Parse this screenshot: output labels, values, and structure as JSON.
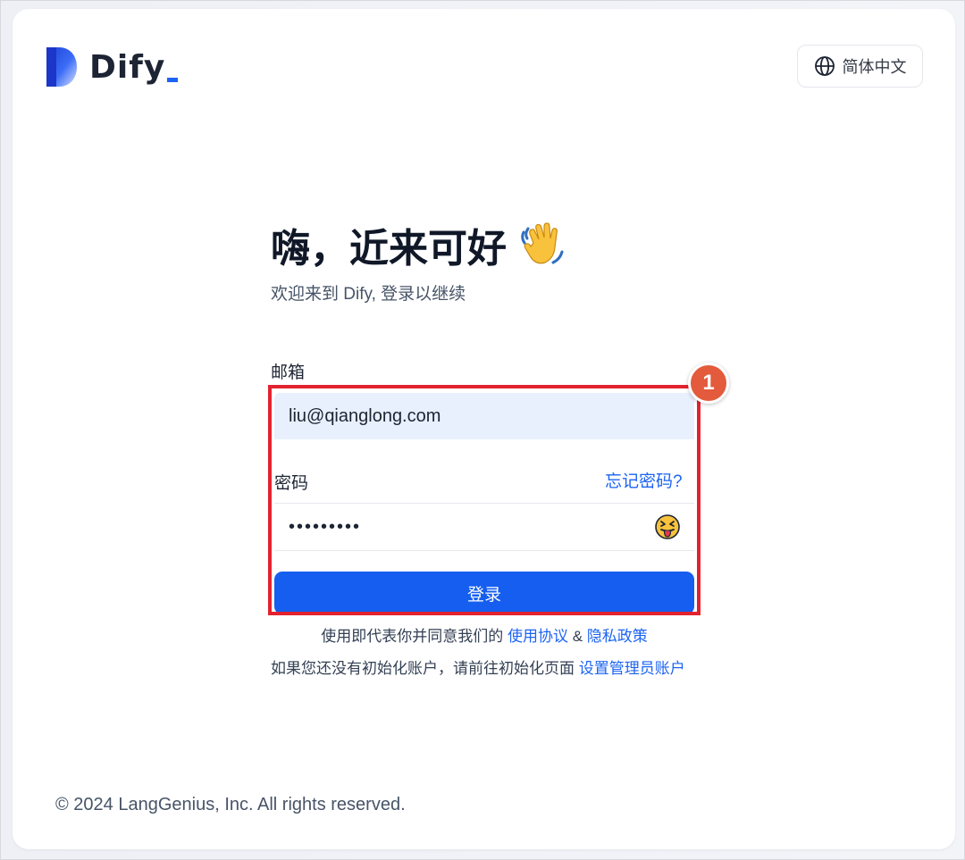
{
  "brand": {
    "name": "Dify"
  },
  "header": {
    "language_label": "简体中文"
  },
  "main": {
    "title": "嗨，近来可好",
    "subtitle": "欢迎来到 Dify, 登录以继续",
    "email_label": "邮箱",
    "email_value": "liu@qianglong.com",
    "password_label": "密码",
    "forgot_link": "忘记密码?",
    "password_value": "•••••••••",
    "submit_label": "登录",
    "terms_prefix": "使用即代表你并同意我们的",
    "terms_link": "使用协议",
    "terms_amp": "&",
    "privacy_link": "隐私政策",
    "setup_prefix": "如果您还没有初始化账户，请前往初始化页面",
    "setup_link": "设置管理员账户"
  },
  "annotation": {
    "badge_number": "1"
  },
  "footer": {
    "copyright": "© 2024 LangGenius, Inc. All rights reserved."
  },
  "colors": {
    "accent": "#155eef",
    "link": "#1c64f2",
    "highlight_border": "#e3222f",
    "badge": "#e35a3c",
    "input_fill": "#e8f0fe"
  },
  "icons": {
    "language": "globe-icon",
    "greeting": "waving-hand-icon",
    "password_toggle": "tongue-emoji-icon"
  }
}
